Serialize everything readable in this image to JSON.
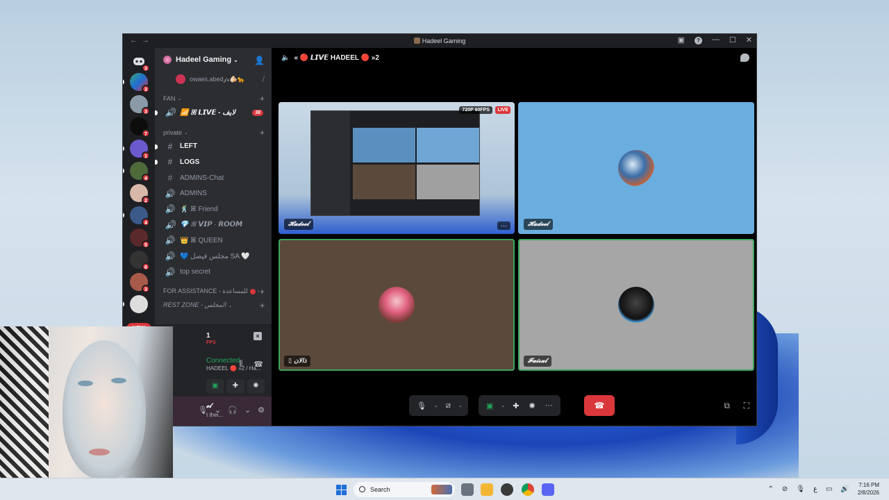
{
  "window": {
    "title": "Hadeel Gaming"
  },
  "rail": {
    "servers": [
      {
        "name": "home",
        "badge": "3",
        "color": "#5865f2"
      },
      {
        "name": "server-2",
        "badge": "3",
        "color": "#3aa56a"
      },
      {
        "name": "server-3",
        "badge": "3",
        "color": "#8a9aa8"
      },
      {
        "name": "server-4",
        "badge": "7",
        "color": "#222222"
      },
      {
        "name": "server-5",
        "badge": "1",
        "color": "#6a5acd"
      },
      {
        "name": "server-6",
        "badge": "4",
        "color": "#4d6b3a"
      },
      {
        "name": "server-7",
        "badge": "2",
        "color": "#d8b8a8"
      },
      {
        "name": "server-8",
        "badge": "4",
        "color": "#3b5a8a"
      },
      {
        "name": "server-9",
        "badge": "5",
        "color": "#5a2a2a"
      },
      {
        "name": "server-10",
        "badge": "6",
        "color": "#333333"
      },
      {
        "name": "server-11",
        "badge": "3",
        "color": "#a85a4a"
      }
    ],
    "new_label": "NEW"
  },
  "sidebar": {
    "guild_name": "Hadeel Gaming",
    "voice_user": "owaes.abed𝓳𝓼🫵🏻🐆",
    "categories": {
      "fan": "FAN",
      "private": "private",
      "assistance": "FOR ASSISTANCE - للمساعدة",
      "rest": "REST ZONE - المجلس"
    },
    "live_channel": {
      "name": "📶 ꕤ 𝙇𝙄𝙑𝙀 - لايف",
      "count": "38"
    },
    "channels": [
      {
        "name": "LEFT",
        "sym": "#",
        "unread": true
      },
      {
        "name": "LOGS",
        "sym": "#",
        "unread": true
      },
      {
        "name": "ADMINS-Chat",
        "sym": "#",
        "unread": false
      },
      {
        "name": "ADMINS",
        "sym": "🔊",
        "unread": false
      },
      {
        "name": "🕺 ꕤ Friend",
        "sym": "🔊",
        "unread": false
      },
      {
        "name": "💎 ꕤ 𝙑𝙄𝙋 · 𝙍𝙊𝙊𝙈",
        "sym": "🔊",
        "unread": false
      },
      {
        "name": "👑 ꕤ QUEEN",
        "sym": "🔊",
        "unread": false
      },
      {
        "name": "💙 مجلس فيصل SA 🤍",
        "sym": "🔊",
        "unread": false
      },
      {
        "name": "top secret",
        "sym": "🔊",
        "unread": false
      }
    ]
  },
  "rtc": {
    "stream_num": "1",
    "stream_fps": "FPS",
    "status": "Connected",
    "channel": "HADEEL 🔴 »2 / Ha...",
    "user_name": "𝓮𝓵",
    "user_status": "t thei..."
  },
  "call": {
    "header": "« 🔴 𝙇𝙄𝙑𝙀 HADEEL 🔴 »2",
    "tiles": [
      {
        "name": "𝓗𝓪𝓭𝓮𝓮𝓵",
        "quality": "720P 60FPS",
        "live": "LIVE",
        "more": "···"
      },
      {
        "name": "𝓗𝓪𝓭𝓮𝓮𝓵"
      },
      {
        "name": "ذالان"
      },
      {
        "name": "𝓕𝓪𝓲𝓼𝓪𝓵"
      }
    ]
  },
  "taskbar": {
    "search": "Search",
    "time": "7:16 PM",
    "date": "2/8/2026"
  }
}
